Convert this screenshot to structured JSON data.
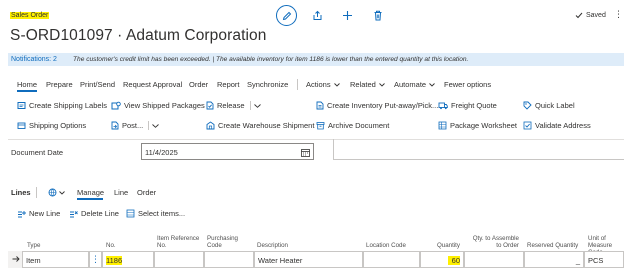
{
  "header": {
    "breadcrumb": "Sales Order",
    "title": "S-ORD101097 · Adatum Corporation",
    "saved_label": "Saved"
  },
  "notification": {
    "label": "Notifications: 2",
    "message": "The customer's credit limit has been exceeded. | The available inventory for item 1186 is lower than the entered quantity at this location."
  },
  "menu": {
    "home": "Home",
    "prepare": "Prepare",
    "print_send": "Print/Send",
    "request_approval": "Request Approval",
    "order": "Order",
    "report": "Report",
    "synchronize": "Synchronize",
    "actions": "Actions",
    "related": "Related",
    "automate": "Automate",
    "fewer_options": "Fewer options"
  },
  "actions": {
    "create_shipping_labels": "Create Shipping Labels",
    "view_shipped_packages": "View Shipped Packages",
    "release": "Release",
    "create_inventory_put": "Create Inventory Put-away/Pick...",
    "freight_quote": "Freight Quote",
    "quick_label": "Quick Label",
    "shipping_options": "Shipping Options",
    "post": "Post...",
    "create_warehouse_shipment": "Create Warehouse Shipment",
    "archive_document": "Archive Document",
    "package_worksheet": "Package Worksheet",
    "validate_address": "Validate Address"
  },
  "document_date": {
    "label": "Document Date",
    "value": "11/4/2025"
  },
  "lines": {
    "title": "Lines",
    "manage": "Manage",
    "line": "Line",
    "order": "Order",
    "new_line": "New Line",
    "delete_line": "Delete Line",
    "select_items": "Select items...",
    "columns": {
      "type": "Type",
      "no": "No.",
      "item_reference_no": "Item Reference No.",
      "purchasing_code": "Purchasing Code",
      "description": "Description",
      "location_code": "Location Code",
      "quantity": "Quantity",
      "qty_to_assemble": "Qty. to Assemble to Order",
      "reserved_quantity": "Reserved Quantity",
      "unit_of_measure_code": "Unit of Measure Code"
    },
    "row": {
      "type": "Item",
      "no": "1186",
      "description": "Water Heater",
      "quantity": "60",
      "reserved_quantity": "_",
      "unit": "PCS"
    }
  }
}
